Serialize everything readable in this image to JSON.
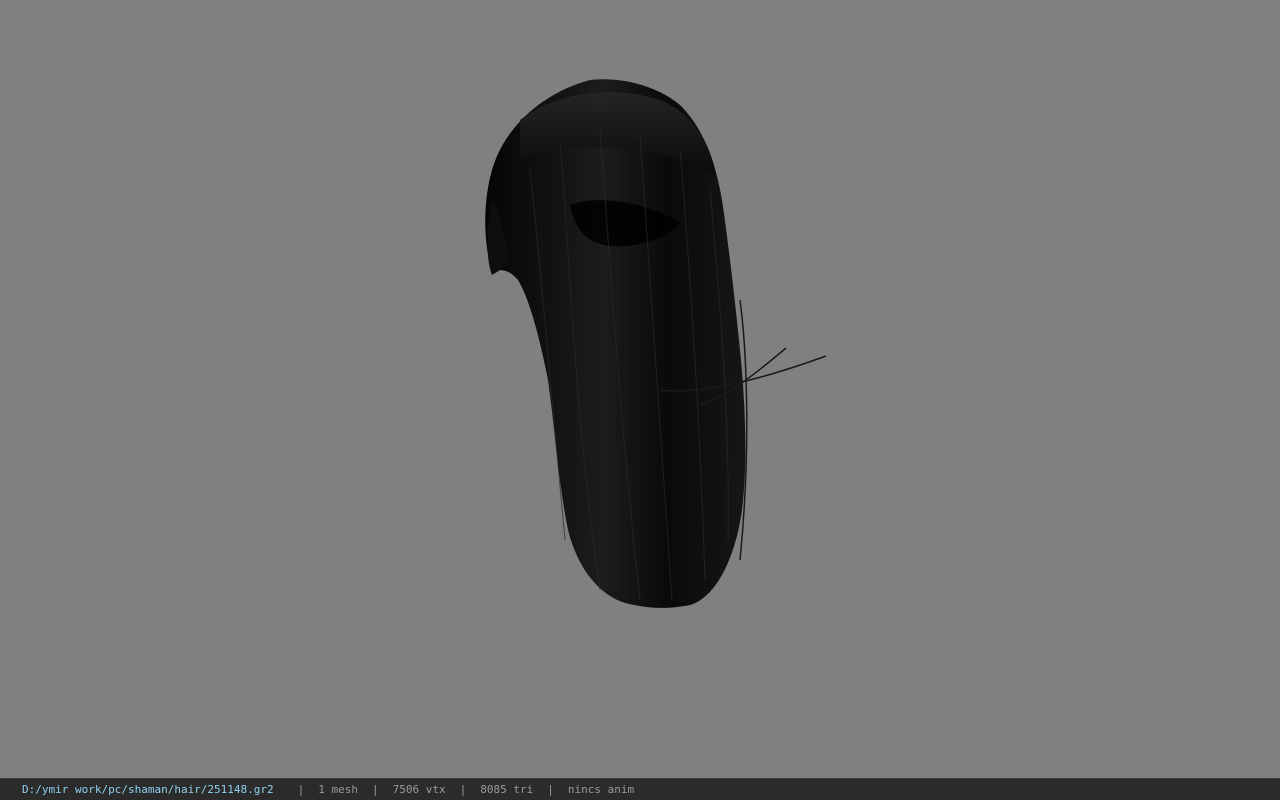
{
  "viewport": {
    "background_color": "#808080",
    "model": {
      "subject": "black long hair mesh",
      "hair_color": "#0d0d0d"
    }
  },
  "status_bar": {
    "file_path": "D:/ymir work/pc/shaman/hair/251148.gr2",
    "separator": "|",
    "mesh_count": "1 mesh",
    "vertex_count": "7506 vtx",
    "triangle_count": "8085 tri",
    "anim_status": "nincs anim",
    "path_color": "#8fd0ee",
    "text_color": "#9a9a9a",
    "background_color": "#2b2b2b"
  }
}
